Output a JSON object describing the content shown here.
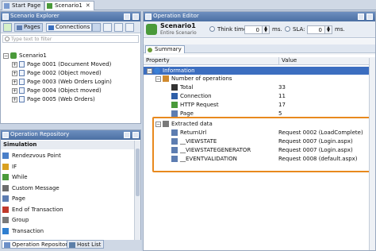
{
  "doc_tabs": [
    {
      "label": "Start Page"
    },
    {
      "label": "Scenario1"
    }
  ],
  "explorer": {
    "title": "Scenario Explorer",
    "toolbar": {
      "pages_label": "Pages",
      "connections_label": "Connections"
    },
    "filter_placeholder": "Type text to filter",
    "root": "Scenario1",
    "pages": [
      "Page 0001 (Document Moved)",
      "Page 0002 (Object moved)",
      "Page 0003 (Web Orders Login)",
      "Page 0004 (Object moved)",
      "Page 0005 (Web Orders)"
    ]
  },
  "repository": {
    "title": "Operation Repository",
    "section": "Simulation",
    "items": [
      {
        "label": "Rendezvous Point",
        "icon": "rendezvous-icon",
        "color": "#4a7fc9"
      },
      {
        "label": "IF",
        "icon": "if-icon",
        "color": "#d9a020"
      },
      {
        "label": "While",
        "icon": "while-icon",
        "color": "#4a9a3a"
      },
      {
        "label": "Custom Message",
        "icon": "message-icon",
        "color": "#6d6d6d"
      },
      {
        "label": "Page",
        "icon": "page-icon",
        "color": "#5d7db1"
      },
      {
        "label": "End of Transaction",
        "icon": "end-transaction-icon",
        "color": "#c0392b"
      },
      {
        "label": "Group",
        "icon": "group-icon",
        "color": "#7a7a7a"
      },
      {
        "label": "Transaction",
        "icon": "transaction-icon",
        "color": "#2f7fd0"
      }
    ]
  },
  "bottom_tabs": [
    {
      "label": "Operation Repository"
    },
    {
      "label": "Host List"
    }
  ],
  "editor": {
    "title": "Operation Editor",
    "scenario_name": "Scenario1",
    "scenario_sub": "Entire Scenario",
    "think_time_label": "Think time:",
    "think_time_value": "0",
    "ms1": "ms.",
    "sla_label": "SLA:",
    "sla_value": "0",
    "ms2": "ms.",
    "summary_tab": "Summary",
    "columns": {
      "property": "Property",
      "value": "Value"
    },
    "rows": [
      {
        "label": "Information",
        "value": "",
        "indent": 0,
        "expander": "-",
        "selected": true,
        "icon": "info-icon"
      },
      {
        "label": "Number of operations",
        "value": "",
        "indent": 1,
        "expander": "-",
        "icon": "chart-icon"
      },
      {
        "label": "Total",
        "value": "33",
        "indent": 2,
        "icon": "sigma-icon"
      },
      {
        "label": "Connection",
        "value": "11",
        "indent": 2,
        "icon": "connection-icon"
      },
      {
        "label": "HTTP Request",
        "value": "17",
        "indent": 2,
        "icon": "request-icon"
      },
      {
        "label": "Page",
        "value": "5",
        "indent": 2,
        "icon": "page-icon"
      },
      {
        "label": "Extracted data",
        "value": "",
        "indent": 1,
        "expander": "-",
        "icon": "extract-icon"
      },
      {
        "label": "ReturnUrl",
        "value": "Request 0002 (LoadComplete)",
        "indent": 2,
        "icon": "variable-icon"
      },
      {
        "label": "__VIEWSTATE",
        "value": "Request 0007 (Login.aspx)",
        "indent": 2,
        "icon": "variable-icon"
      },
      {
        "label": "__VIEWSTATEGENERATOR",
        "value": "Request 0007 (Login.aspx)",
        "indent": 2,
        "icon": "variable-icon"
      },
      {
        "label": "__EVENTVALIDATION",
        "value": "Request 0008 (default.aspx)",
        "indent": 2,
        "icon": "variable-icon"
      }
    ]
  },
  "colors": {
    "highlight": "#e8891e",
    "selection": "#3c6ec0",
    "header": "#4b6fa3"
  }
}
